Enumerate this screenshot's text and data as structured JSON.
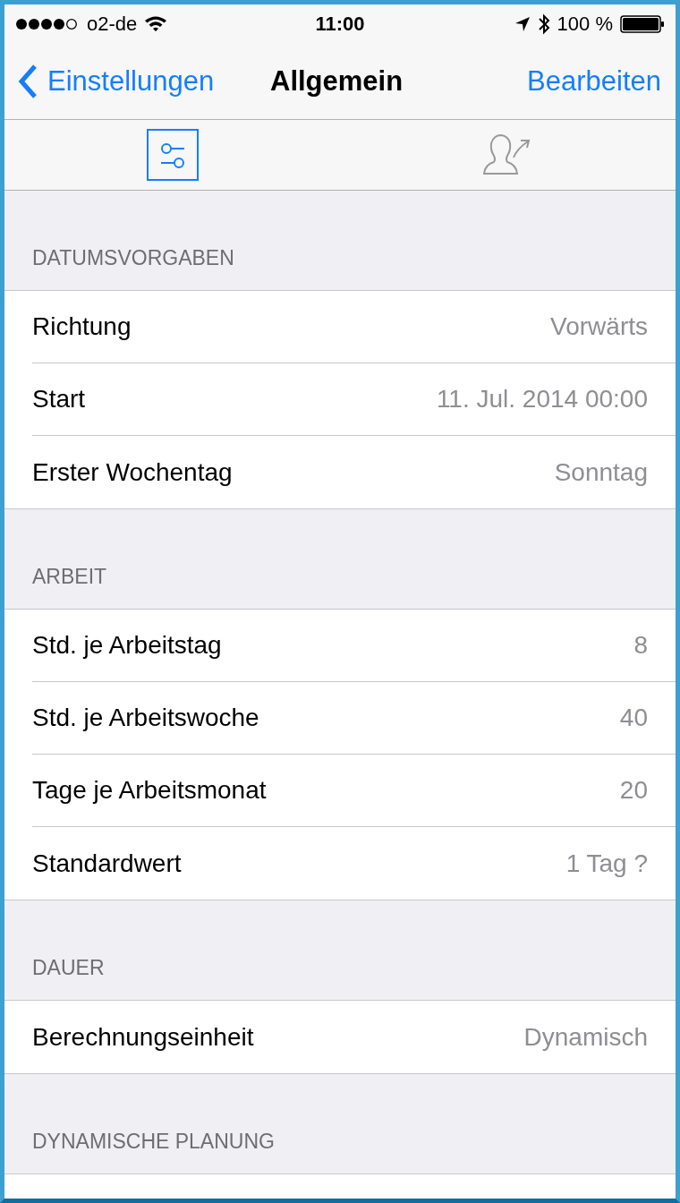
{
  "status_bar": {
    "carrier": "o2-de",
    "time": "11:00",
    "battery": "100 %"
  },
  "nav": {
    "back": "Einstellungen",
    "title": "Allgemein",
    "action": "Bearbeiten"
  },
  "tabs": [
    {
      "kind": "settings",
      "selected": true
    },
    {
      "kind": "share",
      "selected": false
    }
  ],
  "sections": [
    {
      "header": "DATUMSVORGABEN",
      "rows": [
        {
          "label": "Richtung",
          "value": "Vorwärts"
        },
        {
          "label": "Start",
          "value": "11. Jul. 2014 00:00"
        },
        {
          "label": "Erster Wochentag",
          "value": "Sonntag"
        }
      ]
    },
    {
      "header": "ARBEIT",
      "rows": [
        {
          "label": "Std. je Arbeitstag",
          "value": "8"
        },
        {
          "label": "Std. je Arbeitswoche",
          "value": "40"
        },
        {
          "label": "Tage je Arbeitsmonat",
          "value": "20"
        },
        {
          "label": "Standardwert",
          "value": "1 Tag ?"
        }
      ]
    },
    {
      "header": "DAUER",
      "rows": [
        {
          "label": "Berechnungseinheit",
          "value": "Dynamisch"
        }
      ]
    },
    {
      "header": "DYNAMISCHE PLANUNG"
    }
  ]
}
